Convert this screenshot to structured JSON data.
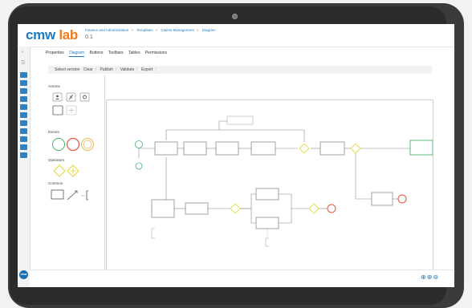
{
  "app": {
    "logo_cmw": "cmw",
    "logo_lab": "lab",
    "version": "0.1"
  },
  "breadcrumb": [
    "Finance and Administration",
    "Templates",
    "Claims Management",
    "Diagram"
  ],
  "breadcrumb_sep": ">",
  "tabs": [
    "Properties",
    "Diagram",
    "Buttons",
    "Toolbars",
    "Tables",
    "Permissions"
  ],
  "active_tab": "Diagram",
  "toolbar": [
    "Select version",
    "Clear",
    "Publish",
    "Validate",
    "Export"
  ],
  "palette": {
    "actions": "Actions",
    "events": "Events",
    "operators": "Operators",
    "common": "Common"
  },
  "avatar_text": "cmw",
  "colors": {
    "brand_blue": "#1e7bc0",
    "brand_orange": "#f07b1e",
    "event_green": "#46b26b",
    "event_red": "#e0573a",
    "event_yellow": "#e8b84a",
    "gateway_yellow": "#e8d84a"
  }
}
